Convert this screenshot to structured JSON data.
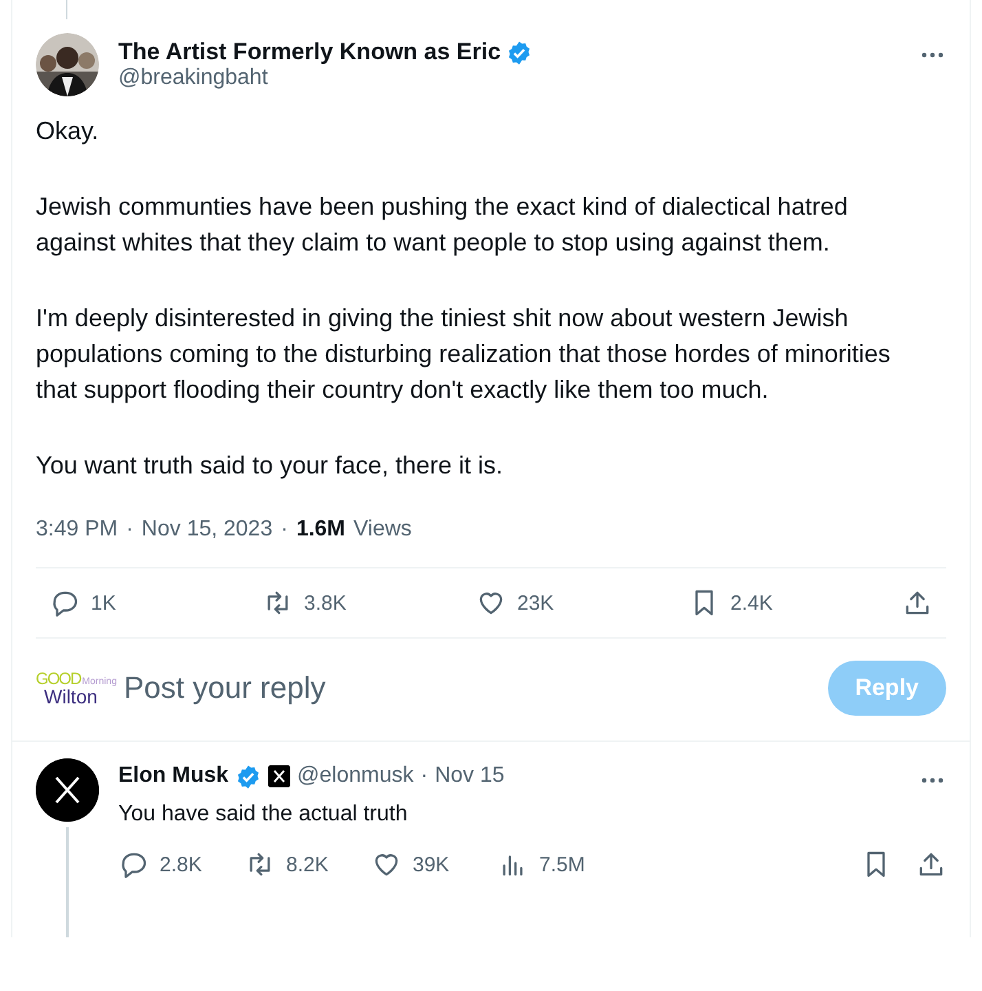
{
  "tweet": {
    "author": {
      "name": "The Artist Formerly Known as Eric",
      "handle": "@breakingbaht",
      "verified": true
    },
    "paragraphs": [
      "Okay.",
      "Jewish communties have been pushing the exact kind of dialectical hatred against whites that they claim to want people to stop using against them.",
      "I'm deeply disinterested in giving the tiniest shit now about western Jewish populations coming to the disturbing realization that those hordes of minorities that support flooding their country don't exactly like them too much.",
      "You want truth said to your face, there it is."
    ],
    "time": "3:49 PM",
    "separator": "·",
    "date": "Nov 15, 2023",
    "views_count": "1.6M",
    "views_label": "Views",
    "actions": [
      {
        "kind": "reply",
        "count": "1K"
      },
      {
        "kind": "repost",
        "count": "3.8K"
      },
      {
        "kind": "like",
        "count": "23K"
      },
      {
        "kind": "bookmark",
        "count": "2.4K"
      },
      {
        "kind": "share"
      }
    ]
  },
  "composer": {
    "avatar": [
      "GOOD",
      "Morning",
      "Wilton"
    ],
    "placeholder": "Post your reply",
    "button": "Reply",
    "disabled": true
  },
  "reply": {
    "author": {
      "name": "Elon Musk",
      "handle": "@elonmusk",
      "separator": "·",
      "date": "Nov 15",
      "verified": true,
      "affiliate": true
    },
    "text": "You have said the actual truth",
    "actions": [
      {
        "kind": "reply",
        "count": "2.8K"
      },
      {
        "kind": "repost",
        "count": "8.2K"
      },
      {
        "kind": "like",
        "count": "39K"
      },
      {
        "kind": "views",
        "count": "7.5M"
      },
      {
        "kind": "bookmark"
      },
      {
        "kind": "share"
      }
    ]
  }
}
